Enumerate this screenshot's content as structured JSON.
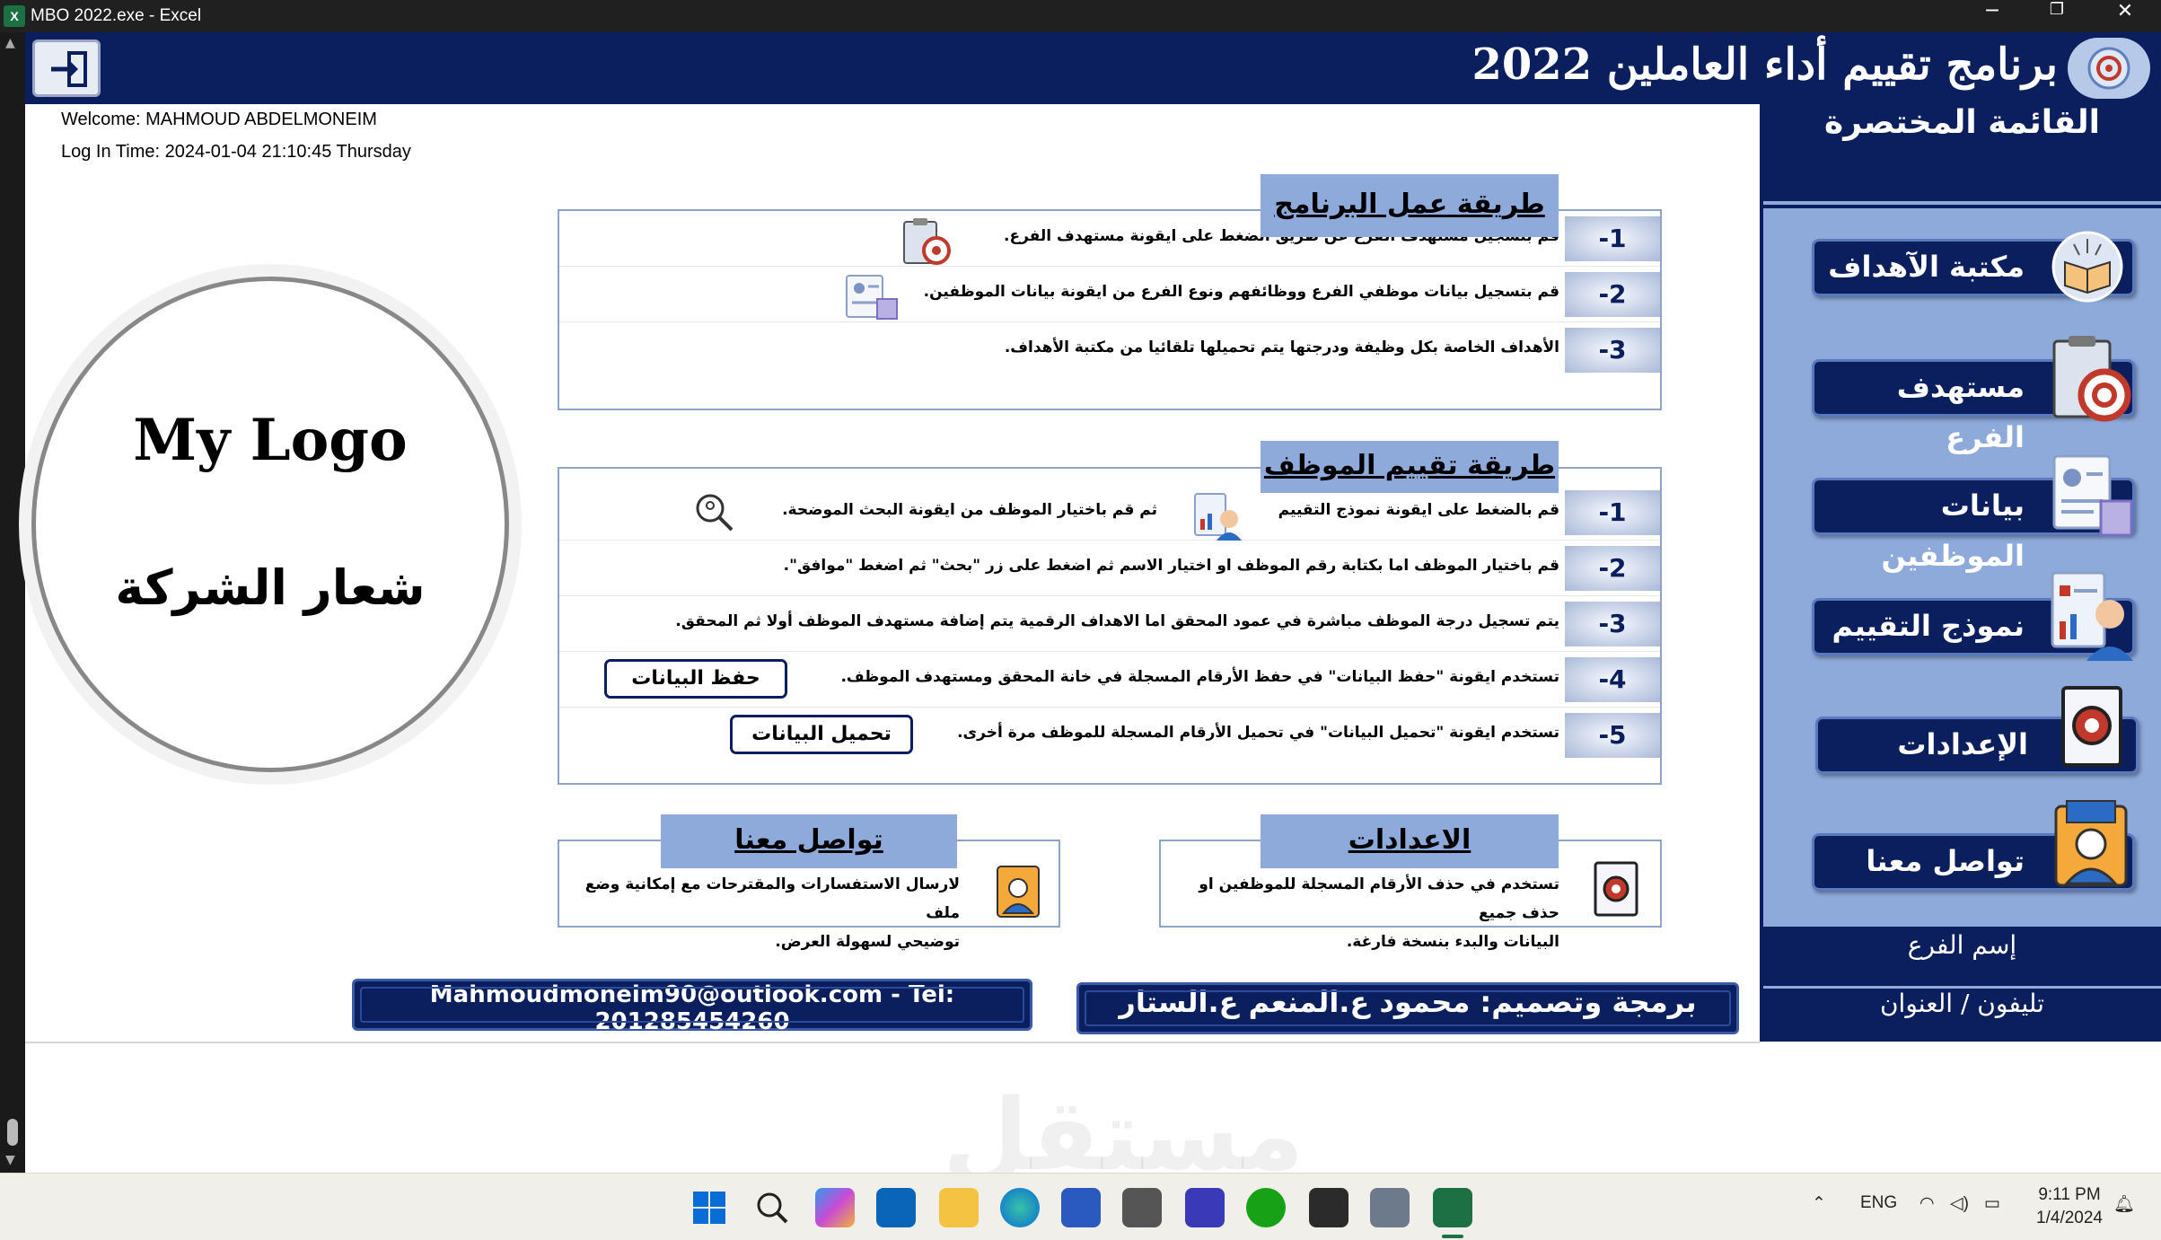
{
  "window": {
    "title": "MBO 2022.exe - Excel",
    "minimize": "─",
    "restore": "❐",
    "close": "✕"
  },
  "header": {
    "title": "برنامج تقييم أداء العاملين 2022"
  },
  "session": {
    "welcome": "Welcome: MAHMOUD ABDELMONEIM",
    "login": "Log In Time: 2024-01-04 21:10:45 Thursday"
  },
  "logo": {
    "en": "My Logo",
    "ar": "شعار الشركة"
  },
  "program_section": {
    "label": "طريقة عمل البرنامج",
    "rows": [
      {
        "num": "-1",
        "text": "قم بتسجيل مستهدف الفرع عن طريق الضغط على ايقونة مستهدف الفرع."
      },
      {
        "num": "-2",
        "text": "قم بتسجيل بيانات موظفي الفرع ووظائفهم ونوع الفرع من ايقونة بيانات الموظفين."
      },
      {
        "num": "-3",
        "text": "الأهداف الخاصة بكل وظيفة ودرجتها يتم تحميلها تلقائيا  من مكتبة الأهداف."
      }
    ]
  },
  "evaluation_section": {
    "label": "طريقة تقييم الموظف",
    "rows": [
      {
        "num": "-1",
        "text": "قم بالضغط على ايقونة نموذج التقييم",
        "text2": "ثم قم باختيار الموظف من ايقونة البحث الموضحة."
      },
      {
        "num": "-2",
        "text": "قم باختيار الموظف اما بكتابة رقم الموظف او اختيار الاسم ثم اضغط على زر \"بحث\" ثم اضغط \"موافق\"."
      },
      {
        "num": "-3",
        "text": "يتم تسجيل درجة الموظف مباشرة في عمود المحقق اما الاهداف الرقمية يتم إضافة مستهدف الموظف أولا ثم المحقق."
      },
      {
        "num": "-4",
        "text": "تستخدم ايقونة \"حفظ البيانات\" في حفظ الأرقام المسجلة في خانة المحقق ومستهدف الموظف.",
        "button": "حفظ البيانات"
      },
      {
        "num": "-5",
        "text": "تستخدم ايقونة \"تحميل البيانات\" في تحميل الأرقام المسجلة للموظف مرة أخرى.",
        "button": "تحميل البيانات"
      }
    ]
  },
  "contact_box": {
    "label": "تواصل معنا",
    "line1": "لارسال الاستفسارات والمقترحات مع إمكانية وضع ملف",
    "line2": "توضيحي لسهولة العرض."
  },
  "settings_box": {
    "label": "الاعدادات",
    "line1": "تستخدم في حذف الأرقام المسجلة للموظفين او حذف جميع",
    "line2": "البيانات والبدء بنسخة فارغة."
  },
  "footer": {
    "email": "Mahmoudmoneim90@outlook.com  - Tel: 201285454260",
    "credit": "برمجة وتصميم: محمود ع.المنعم ع.الستار"
  },
  "sidebar": {
    "title": "القائمة المختصرة",
    "items": [
      {
        "label": "مكتبة الآهداف"
      },
      {
        "label": "مستهدف الفرع"
      },
      {
        "label": "بيانات الموظفين"
      },
      {
        "label": "نموذج التقييم"
      },
      {
        "label": "الإعدادات"
      },
      {
        "label": "تواصل معنا"
      }
    ],
    "branch_name": "إسم الفرع",
    "branch_phone": "تليفون / العنوان"
  },
  "taskbar": {
    "lang": "ENG",
    "time": "9:11 PM",
    "date": "1/4/2024"
  },
  "watermark": "مستقل",
  "colors": {
    "navy": "#0b1f5e",
    "accent": "#8eaadb",
    "excel_green": "#1d7044"
  }
}
